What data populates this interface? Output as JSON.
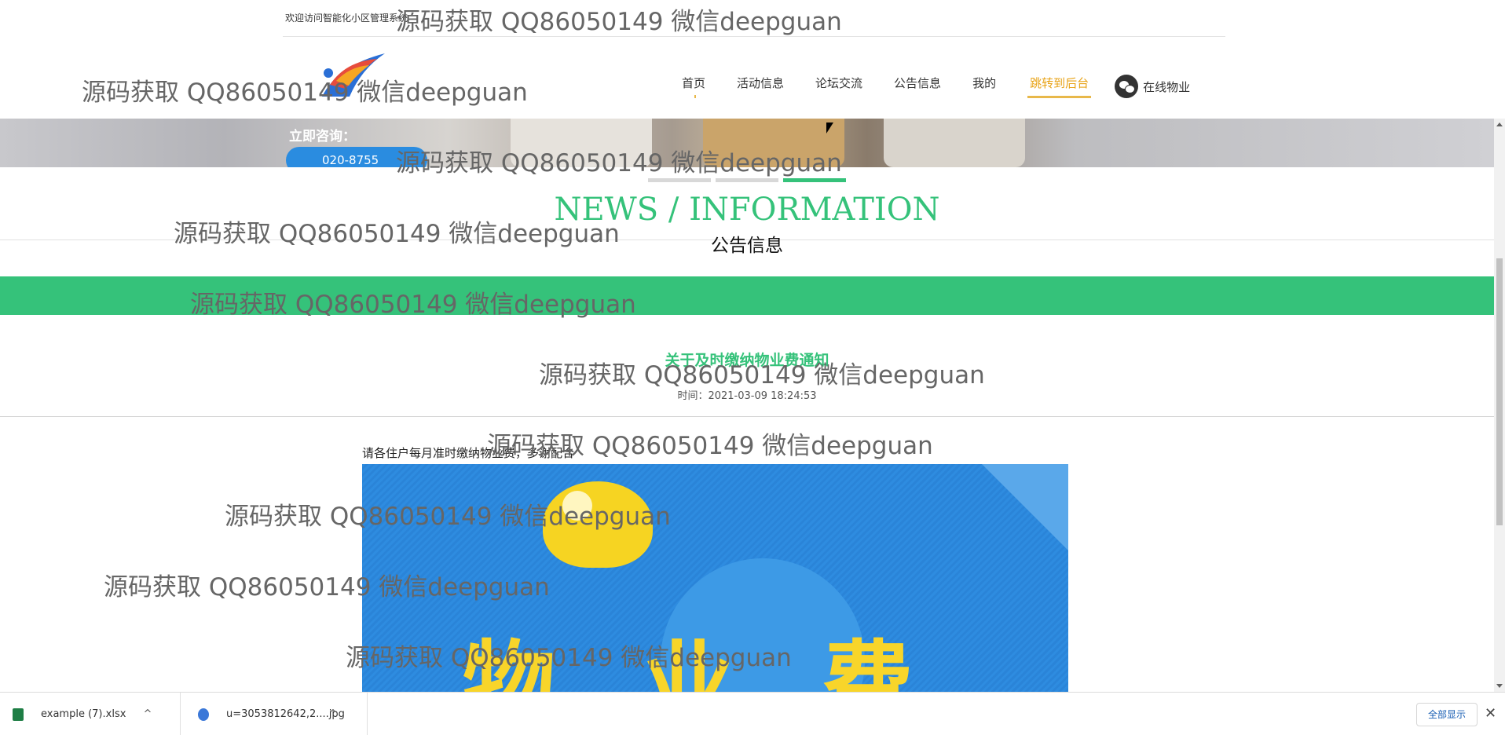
{
  "site": {
    "welcome": "欢迎访问智能化小区管理系统"
  },
  "nav": {
    "items": [
      "首页",
      "活动信息",
      "论坛交流",
      "公告信息",
      "我的"
    ],
    "admin": "跳转到后台",
    "service": "在线物业"
  },
  "banner": {
    "consult": "立即咨询：",
    "phone": "020-8755"
  },
  "section": {
    "title_en": "NEWS / INFORMATION",
    "title_cn": "公告信息"
  },
  "notice": {
    "title": "关于及时缴纳物业费通知",
    "time": "时间：2021-03-09 18:24:53",
    "body": "请各住户每月准时缴纳物业费，多谢配合",
    "poster_text": "物业费"
  },
  "watermark": "源码获取 QQ86050149 微信deepguan",
  "downloads": {
    "items": [
      {
        "name": "example (7).xlsx",
        "icon": "excel-file-icon",
        "color": "#1e7e45"
      },
      {
        "name": "u=3053812642,2....jpg",
        "icon": "image-file-icon",
        "color": "#3b78d8"
      }
    ],
    "show_all": "全部显示"
  },
  "colors": {
    "accent": "#35c27a",
    "admin": "#e8a317"
  }
}
